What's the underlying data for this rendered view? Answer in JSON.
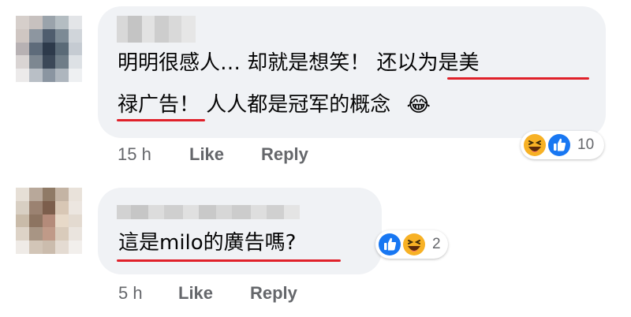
{
  "comments": [
    {
      "text_line1": "明明很感人… 却就是想笑！ 还以为是美",
      "text_line2": "禄广告！ 人人都是冠军的概念",
      "text_emoji": "😂",
      "time": "15 h",
      "like_label": "Like",
      "reply_label": "Reply",
      "reactions": [
        "haha",
        "like"
      ],
      "reaction_count": "10"
    },
    {
      "text_line1": "這是milo的廣告嗎?",
      "time": "5 h",
      "like_label": "Like",
      "reply_label": "Reply",
      "reactions": [
        "like",
        "haha"
      ],
      "reaction_count": "2"
    }
  ],
  "colors": {
    "bubble": "#f0f2f5",
    "meta_text": "#65676b",
    "underline": "#e0212a",
    "like_blue": "#1877f2",
    "haha_yellow": "#f7b125"
  }
}
